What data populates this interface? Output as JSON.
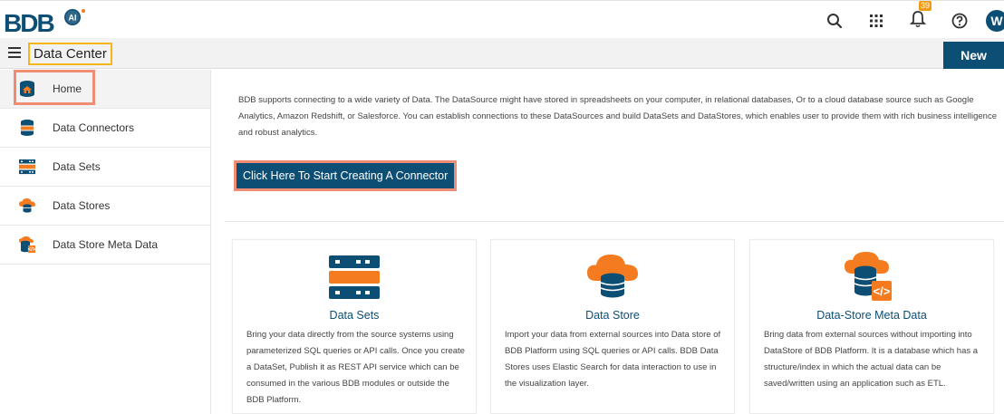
{
  "header": {
    "logo_text": "BDB",
    "logo_badge": "AI",
    "notification_count": "39",
    "avatar_initial": "W",
    "icons": [
      "search-icon",
      "apps-grid-icon",
      "bell-icon",
      "help-icon"
    ]
  },
  "subbar": {
    "title": "Data Center",
    "new_label": "New"
  },
  "sidebar": {
    "items": [
      {
        "label": "Home",
        "icon": "home-database-icon"
      },
      {
        "label": "Data Connectors",
        "icon": "database-icon"
      },
      {
        "label": "Data Sets",
        "icon": "server-stack-icon"
      },
      {
        "label": "Data Stores",
        "icon": "cloud-database-icon"
      },
      {
        "label": "Data Store Meta Data",
        "icon": "meta-data-icon"
      }
    ]
  },
  "main": {
    "intro": "BDB supports connecting to a wide variety of Data. The DataSource might have stored in spreadsheets on your computer, in relational databases, Or to a cloud database source such as Google Analytics, Amazon Redshift, or Salesforce. You can establish connections to these DataSources and build DataSets and DataStores, which enables user to provide them with rich business intelligence and robust analytics.",
    "cta_label": "Click Here To Start Creating A Connector",
    "cards": [
      {
        "title": "Data Sets",
        "description": "Bring your data directly from the source systems using parameterized SQL queries or API calls. Once you create a DataSet, Publish it as REST API service which can be consumed in the various BDB modules or outside the BDB Platform."
      },
      {
        "title": "Data Store",
        "description": "Import your data from external sources into Data store of BDB Platform using SQL queries or API calls. BDB Data Stores uses Elastic Search for data interaction to use in the visualization layer."
      },
      {
        "title": "Data-Store Meta Data",
        "description": "Bring data from external sources without importing into DataStore of BDB Platform. It is a database which has a structure/index in which the actual data can be saved/written using an application such as ETL."
      }
    ]
  },
  "colors": {
    "primary": "#0d4e74",
    "accent_orange": "#f47b20",
    "highlight_yellow": "#f5b51b",
    "highlight_salmon": "#ef8c74"
  }
}
